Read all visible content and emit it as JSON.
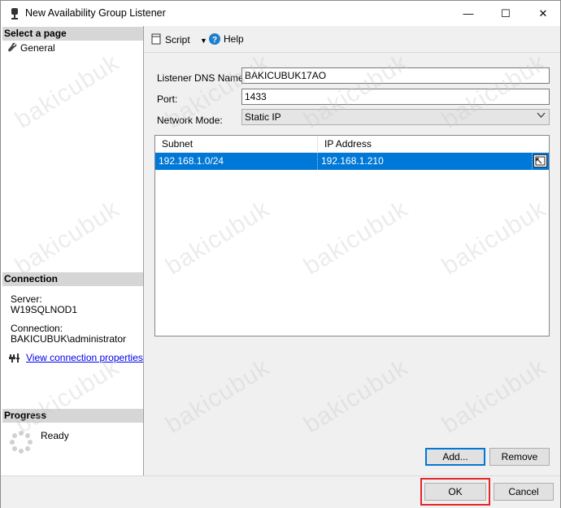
{
  "window": {
    "title": "New Availability Group Listener",
    "controls": {
      "minimize": "—",
      "maximize": "☐",
      "close": "✕"
    }
  },
  "sidebar": {
    "select_page_heading": "Select a page",
    "pages": [
      {
        "label": "General",
        "icon": "wrench-icon"
      }
    ],
    "connection_heading": "Connection",
    "server_label": "Server:",
    "server_value": "W19SQLNOD1",
    "connection_label": "Connection:",
    "connection_value": "BAKICUBUK\\administrator",
    "view_connection_properties": "View connection properties",
    "progress_heading": "Progress",
    "progress_status": "Ready"
  },
  "toolbar": {
    "script_label": "Script",
    "help_label": "Help"
  },
  "form": {
    "dns_name_label": "Listener DNS Name:",
    "dns_name_value": "BAKICUBUK17AO",
    "port_label": "Port:",
    "port_value": "1433",
    "network_mode_label": "Network Mode:",
    "network_mode_value": "Static IP"
  },
  "grid": {
    "columns": [
      "Subnet",
      "IP Address"
    ],
    "rows": [
      {
        "subnet": "192.168.1.0/24",
        "ip_address": "192.168.1.210"
      }
    ]
  },
  "buttons": {
    "add": "Add...",
    "remove": "Remove",
    "ok": "OK",
    "cancel": "Cancel"
  },
  "watermark": {
    "text": "bakicubuk"
  },
  "colors": {
    "selection": "#0078d7",
    "highlight_border": "#e4262b",
    "link": "#0000ee"
  }
}
